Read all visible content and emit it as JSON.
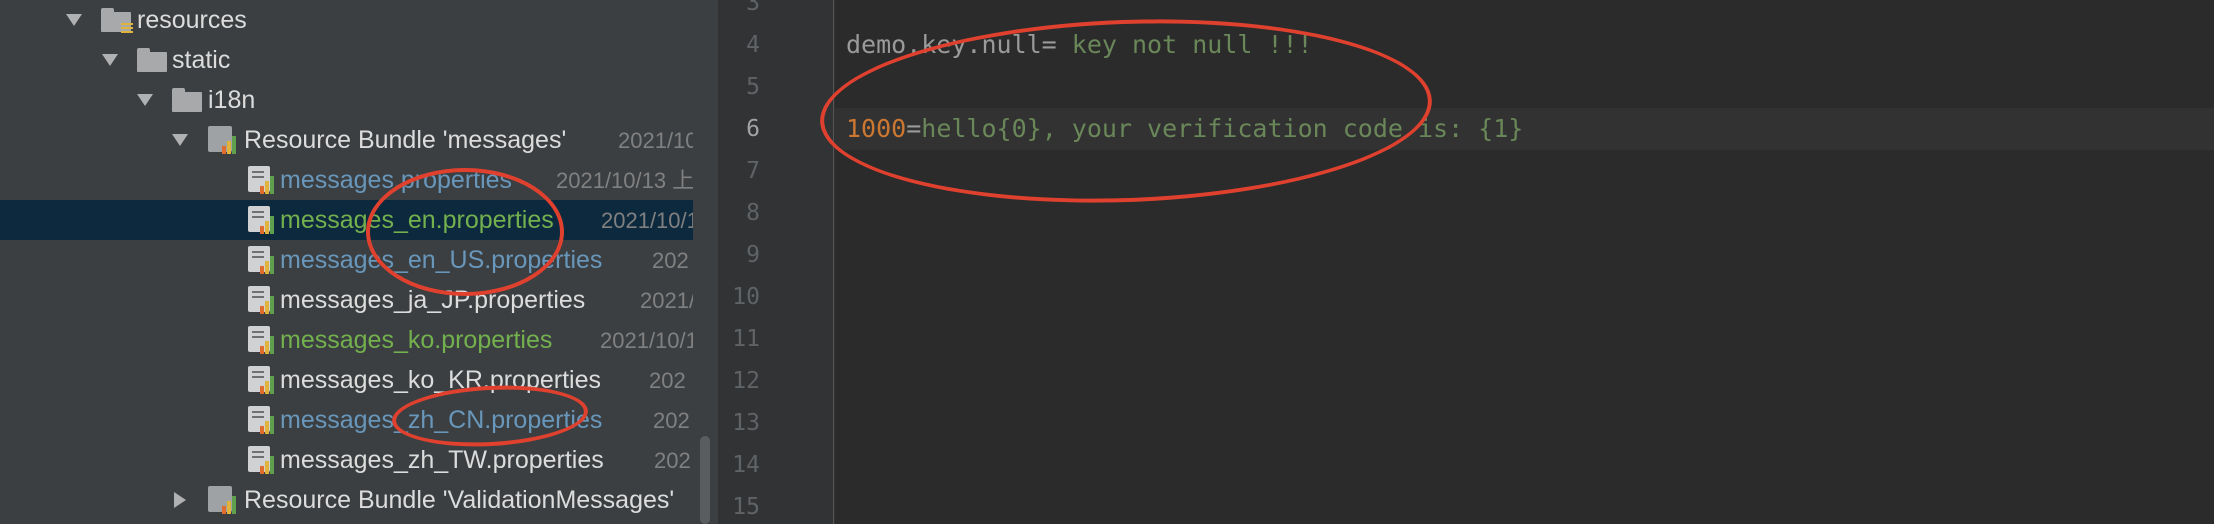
{
  "project_tree": {
    "items": [
      {
        "label": "resources",
        "meta": "",
        "kind": "folder",
        "expanded": true
      },
      {
        "label": "static",
        "meta": "",
        "kind": "folder",
        "expanded": true
      },
      {
        "label": "i18n",
        "meta": "",
        "kind": "folder",
        "expanded": true
      },
      {
        "label": "Resource Bundle 'messages'",
        "meta": "2021/10",
        "kind": "bundle",
        "expanded": true
      },
      {
        "label": "messages.properties",
        "meta": "2021/10/13 上",
        "kind": "file"
      },
      {
        "label": "messages_en.properties",
        "meta": "2021/10/1",
        "kind": "file",
        "selected": true
      },
      {
        "label": "messages_en_US.properties",
        "meta": "202",
        "kind": "file"
      },
      {
        "label": "messages_ja_JP.properties",
        "meta": "2021/",
        "kind": "file"
      },
      {
        "label": "messages_ko.properties",
        "meta": "2021/10/1",
        "kind": "file"
      },
      {
        "label": "messages_ko_KR.properties",
        "meta": "202",
        "kind": "file"
      },
      {
        "label": "messages_zh_CN.properties",
        "meta": "202",
        "kind": "file"
      },
      {
        "label": "messages_zh_TW.properties",
        "meta": "202",
        "kind": "file"
      },
      {
        "label": "Resource Bundle 'ValidationMessages'",
        "meta": "",
        "kind": "bundle",
        "expanded": false
      }
    ]
  },
  "editor": {
    "line_numbers": [
      "3",
      "4",
      "5",
      "6",
      "7",
      "8",
      "9",
      "10",
      "11",
      "12",
      "13",
      "14",
      "15"
    ],
    "current_line": "6",
    "line4": {
      "key": "demo.key.null",
      "eq": "=",
      "value": " key not null !!!"
    },
    "line6": {
      "key": "1000",
      "eq": "=",
      "value": "hello{0}, your verification code is: {1}"
    }
  },
  "colors": {
    "annotation": "#e0412f",
    "panel_bg": "#3c3f41",
    "editor_bg": "#2b2b2b",
    "selection": "#0d293e"
  },
  "icons": {
    "tree_expanded": "chevron-down-icon",
    "tree_collapsed": "chevron-right-icon",
    "folder": "folder-icon",
    "resources_folder": "resources-folder-icon",
    "bundle": "resource-bundle-icon",
    "properties": "properties-file-icon"
  }
}
